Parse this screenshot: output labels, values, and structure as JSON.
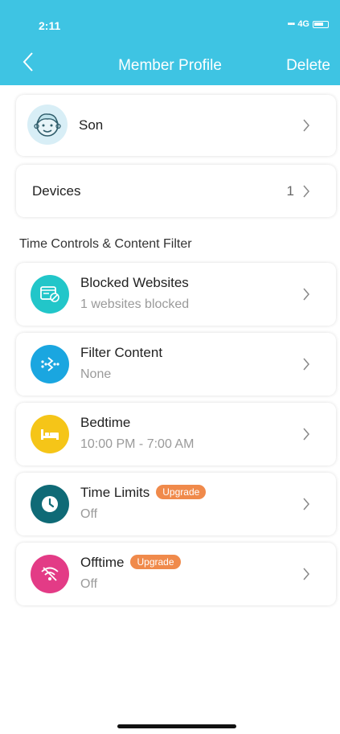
{
  "status": {
    "time": "2:11",
    "network": "4G"
  },
  "nav": {
    "title": "Member Profile",
    "delete_label": "Delete"
  },
  "profile": {
    "name": "Son"
  },
  "devices": {
    "label": "Devices",
    "count": "1"
  },
  "section_title": "Time Controls & Content Filter",
  "items": [
    {
      "title": "Blocked Websites",
      "subtitle": "1 websites blocked",
      "color": "#22c6c9",
      "icon": "blocked-websites-icon"
    },
    {
      "title": "Filter Content",
      "subtitle": "None",
      "color": "#1aa6e0",
      "icon": "filter-content-icon"
    },
    {
      "title": "Bedtime",
      "subtitle": "10:00 PM - 7:00 AM",
      "color": "#f5c518",
      "icon": "bed-icon"
    },
    {
      "title": "Time Limits",
      "subtitle": "Off",
      "color": "#0f6a76",
      "icon": "clock-icon",
      "badge": "Upgrade"
    },
    {
      "title": "Offtime",
      "subtitle": "Off",
      "color": "#e33b86",
      "icon": "wifi-off-icon",
      "badge": "Upgrade"
    }
  ],
  "colors": {
    "header": "#3ec4e3",
    "badge": "#f08a4b"
  }
}
